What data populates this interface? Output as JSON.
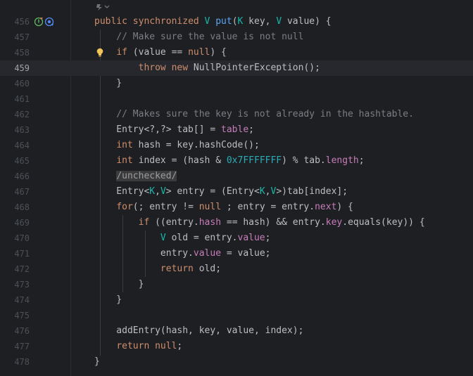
{
  "editor": {
    "current_line": "459",
    "lines": [
      {
        "n": "456"
      },
      {
        "n": "457"
      },
      {
        "n": "458"
      },
      {
        "n": "459"
      },
      {
        "n": "460"
      },
      {
        "n": "461"
      },
      {
        "n": "462"
      },
      {
        "n": "463"
      },
      {
        "n": "464"
      },
      {
        "n": "465"
      },
      {
        "n": "466"
      },
      {
        "n": "467"
      },
      {
        "n": "468"
      },
      {
        "n": "469"
      },
      {
        "n": "470"
      },
      {
        "n": "471"
      },
      {
        "n": "472"
      },
      {
        "n": "473"
      },
      {
        "n": "474"
      },
      {
        "n": "475"
      },
      {
        "n": "476"
      },
      {
        "n": "477"
      },
      {
        "n": "478"
      }
    ],
    "code": {
      "l456": {
        "a": "public",
        "b": " ",
        "c": "synchronized",
        "d": " ",
        "e": "V",
        "f": " ",
        "g": "put",
        "h": "(",
        "i": "K",
        "j": " key, ",
        "k": "V",
        "l": " value) {"
      },
      "l457": {
        "a": "    // Make sure the value is not null"
      },
      "l458": {
        "a": "    ",
        "b": "if",
        "c": " (value == ",
        "d": "null",
        "e": ") {"
      },
      "l459": {
        "a": "        ",
        "b": "throw",
        "c": " ",
        "d": "new",
        "e": " NullPointerException();"
      },
      "l460": {
        "a": "    }"
      },
      "l462": {
        "a": "    // Makes sure the key is not already in the hashtable."
      },
      "l463": {
        "a": "    Entry<?,?> tab[] = ",
        "b": "table",
        "c": ";"
      },
      "l464": {
        "a": "    ",
        "b": "int",
        "c": " hash = key.hashCode();"
      },
      "l465": {
        "a": "    ",
        "b": "int",
        "c": " index = (hash & ",
        "d": "0x7FFFFFFF",
        "e": ") % tab.",
        "f": "length",
        "g": ";"
      },
      "l466": {
        "a": "    ",
        "b": "/unchecked/"
      },
      "l467": {
        "a": "    Entry<",
        "b": "K",
        "c": ",",
        "d": "V",
        "e": "> entry = (Entry<",
        "f": "K",
        "g": ",",
        "h": "V",
        "i": ">)tab[index];"
      },
      "l468": {
        "a": "    ",
        "b": "for",
        "c": "(; entry != ",
        "d": "null",
        "e": " ; entry = entry.",
        "f": "next",
        "g": ") {"
      },
      "l469": {
        "a": "        ",
        "b": "if",
        "c": " ((entry.",
        "d": "hash",
        "e": " == hash) && entry.",
        "f": "key",
        "g": ".equals(key)) {"
      },
      "l470": {
        "a": "            ",
        "b": "V",
        "c": " old = entry.",
        "d": "value",
        "e": ";"
      },
      "l471": {
        "a": "            entry.",
        "b": "value",
        "c": " = value;"
      },
      "l472": {
        "a": "            ",
        "b": "return",
        "c": " old;"
      },
      "l473": {
        "a": "        }"
      },
      "l474": {
        "a": "    }"
      },
      "l476": {
        "a": "    addEntry(hash, key, value, index);"
      },
      "l477": {
        "a": "    ",
        "b": "return",
        "c": " ",
        "d": "null",
        "e": ";"
      },
      "l478": {
        "a": "}"
      }
    },
    "icons": {
      "implements": "implements-method-icon",
      "override": "override-method-icon",
      "bulb": "intention-bulb-icon",
      "hint": "code-vision-hint-icon"
    },
    "colors": {
      "background": "#1e1f22",
      "keyword": "#cf8e6d",
      "type_param": "#16baac",
      "method": "#56a8f5",
      "field": "#c77dbb",
      "number": "#2aacb8",
      "comment": "#7a7e85",
      "current_line": "#26282e"
    }
  }
}
